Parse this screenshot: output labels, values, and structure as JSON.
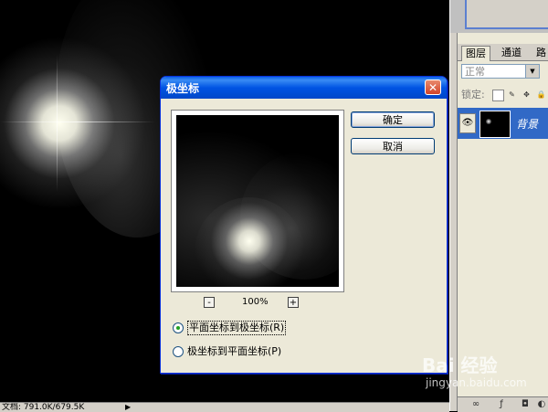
{
  "status_bar": {
    "text": "文档: 791.0K/679.5K",
    "arrow": "▶"
  },
  "layers_panel": {
    "tabs": [
      "图层",
      "通道",
      "路"
    ],
    "blend_mode": "正常",
    "lock_label": "锁定:",
    "layer": {
      "name": "背景",
      "visible_icon": "eye-icon"
    },
    "bottom_icons": [
      "link-icon",
      "fx-icon",
      "mask-icon",
      "adjustment-icon"
    ]
  },
  "dialog": {
    "title": "极坐标",
    "close_glyph": "✕",
    "ok_label": "确定",
    "cancel_label": "取消",
    "zoom_out": "-",
    "zoom_in": "+",
    "zoom_value": "100%",
    "options": [
      {
        "label": "平面坐标到极坐标(R)",
        "selected": true
      },
      {
        "label": "极坐标到平面坐标(P)",
        "selected": false
      }
    ]
  },
  "watermark": {
    "logo": "Bai 经验",
    "sub": "jingyan.baidu.com"
  }
}
